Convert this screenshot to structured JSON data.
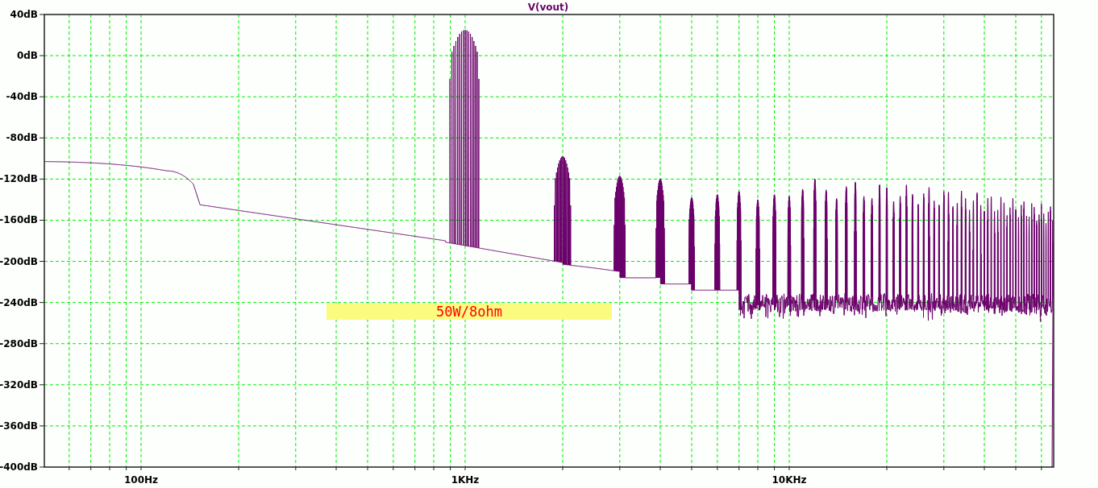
{
  "plot": {
    "title": "V(vout)",
    "y_axis": {
      "labels": [
        "40dB",
        "0dB",
        "-40dB",
        "-80dB",
        "-120dB",
        "-160dB",
        "-200dB",
        "-240dB",
        "-280dB",
        "-320dB",
        "-360dB",
        "-400dB"
      ]
    },
    "x_axis": {
      "labels": [
        "100Hz",
        "1KHz",
        "10KHz"
      ]
    },
    "annotation": {
      "text": "50W/8ohm"
    }
  }
}
